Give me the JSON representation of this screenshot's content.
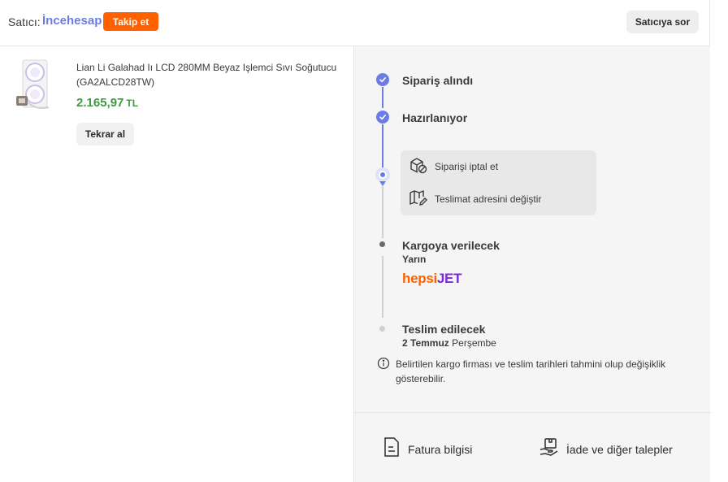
{
  "header": {
    "seller_label": "Satıcı:",
    "seller_name": "İncehesap",
    "follow_label": "Takip et",
    "ask_label": "Satıcıya sor"
  },
  "product": {
    "title": "Lian Li Galahad Iı LCD 280MM Beyaz Işlemci Sıvı Soğutucu (GA2ALCD28TW)",
    "price": "2.165,97",
    "currency": "TL",
    "rebuy_label": "Tekrar al"
  },
  "tracking": {
    "steps": [
      {
        "title": "Sipariş alındı"
      },
      {
        "title": "Hazırlanıyor"
      },
      {
        "title": "Kargoya verilecek",
        "sub": "Yarın"
      },
      {
        "title": "Teslim edilecek",
        "sub_bold": "2 Temmuz",
        "sub": "Perşembe"
      }
    ],
    "actions": [
      {
        "label": "Siparişi iptal et",
        "icon": "cancel-package-icon"
      },
      {
        "label": "Teslimat adresini değiştir",
        "icon": "map-edit-icon"
      }
    ],
    "carrier": {
      "part1": "hepsi",
      "part2": "JET",
      "color1": "#ff6000",
      "color2": "#7a2ad6"
    },
    "info_text": "Belirtilen kargo firması ve teslim tarihleri tahmini olup değişiklik gösterebilir."
  },
  "footer": {
    "invoice_label": "Fatura bilgisi",
    "returns_label": "İade ve diğer talepler"
  },
  "colors": {
    "accent": "#6b7ce6",
    "orange": "#ff6000",
    "price_green": "#3f9a3f"
  }
}
